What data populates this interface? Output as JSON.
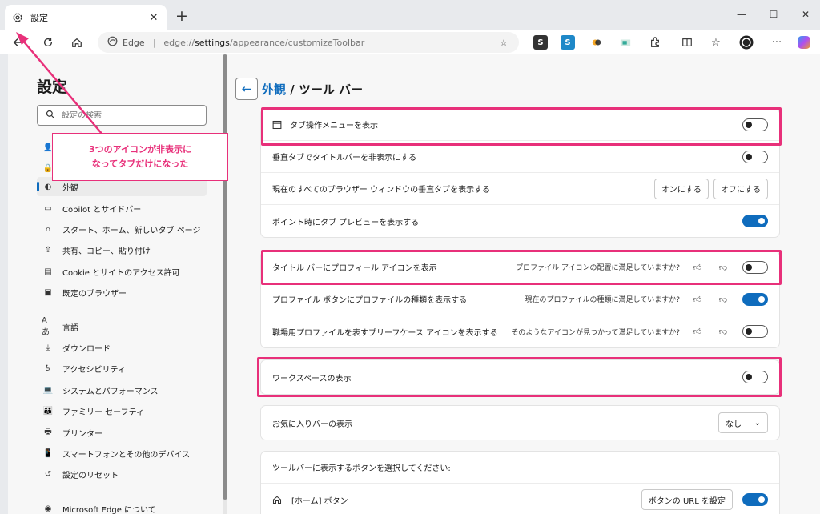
{
  "tab": {
    "title": "設定",
    "icon": "gear-icon"
  },
  "address": {
    "brand": "Edge",
    "url_prefix": "edge://",
    "url_host": "settings",
    "url_path": "/appearance/customizeToolbar"
  },
  "sidebar": {
    "title": "設定",
    "search_placeholder": "設定の検索",
    "items": [
      {
        "label": "外観",
        "icon": "appearance-icon"
      },
      {
        "label": "Copilot とサイドバー",
        "icon": "sidebar-icon"
      },
      {
        "label": "スタート、ホーム、新しいタブ ページ",
        "icon": "home-icon"
      },
      {
        "label": "共有、コピー、貼り付け",
        "icon": "share-icon"
      },
      {
        "label": "Cookie とサイトのアクセス許可",
        "icon": "cookie-icon"
      },
      {
        "label": "既定のブラウザー",
        "icon": "browser-icon"
      },
      {
        "label": "言語",
        "icon": "language-icon"
      },
      {
        "label": "ダウンロード",
        "icon": "download-icon"
      },
      {
        "label": "アクセシビリティ",
        "icon": "accessibility-icon"
      },
      {
        "label": "システムとパフォーマンス",
        "icon": "laptop-icon"
      },
      {
        "label": "ファミリー セーフティ",
        "icon": "family-icon"
      },
      {
        "label": "プリンター",
        "icon": "printer-icon"
      },
      {
        "label": "スマートフォンとその他のデバイス",
        "icon": "phone-icon"
      },
      {
        "label": "設定のリセット",
        "icon": "reset-icon"
      },
      {
        "label": "Microsoft Edge について",
        "icon": "edge-icon"
      }
    ]
  },
  "callout": {
    "line1": "3つのアイコンが非表示に",
    "line2": "なってタブだけになった"
  },
  "main": {
    "crumb_link": "外観",
    "crumb_rest": " / ツール バー",
    "card1": [
      {
        "label": "タブ操作メニューを表示",
        "toggle": false
      },
      {
        "label": "垂直タブでタイトルバーを非表示にする",
        "toggle": false
      },
      {
        "label": "現在のすべてのブラウザー ウィンドウの垂直タブを表示する",
        "btn_on": "オンにする",
        "btn_off": "オフにする"
      },
      {
        "label": "ポイント時にタブ プレビューを表示する",
        "toggle": true
      }
    ],
    "card2": [
      {
        "label": "タイトル バーにプロフィール アイコンを表示",
        "question": "プロファイル アイコンの配置に満足していますか?",
        "toggle": false
      },
      {
        "label": "プロファイル ボタンにプロファイルの種類を表示する",
        "question": "現在のプロファイルの種類に満足していますか?",
        "toggle": true
      },
      {
        "label": "職場用プロファイルを表すブリーフケース アイコンを表示する",
        "question": "そのようなアイコンが見つかって満足していますか?",
        "toggle": false
      }
    ],
    "card3": {
      "label": "ワークスペースの表示",
      "toggle": false
    },
    "card4": {
      "label": "お気に入りバーの表示",
      "value": "なし"
    },
    "card5": {
      "heading": "ツールバーに表示するボタンを選択してください:",
      "home_label": "[ホーム] ボタン",
      "home_button": "ボタンの URL を設定",
      "toggle": true
    }
  },
  "colors": {
    "accent": "#0f6cbd",
    "highlight": "#e8307a"
  }
}
